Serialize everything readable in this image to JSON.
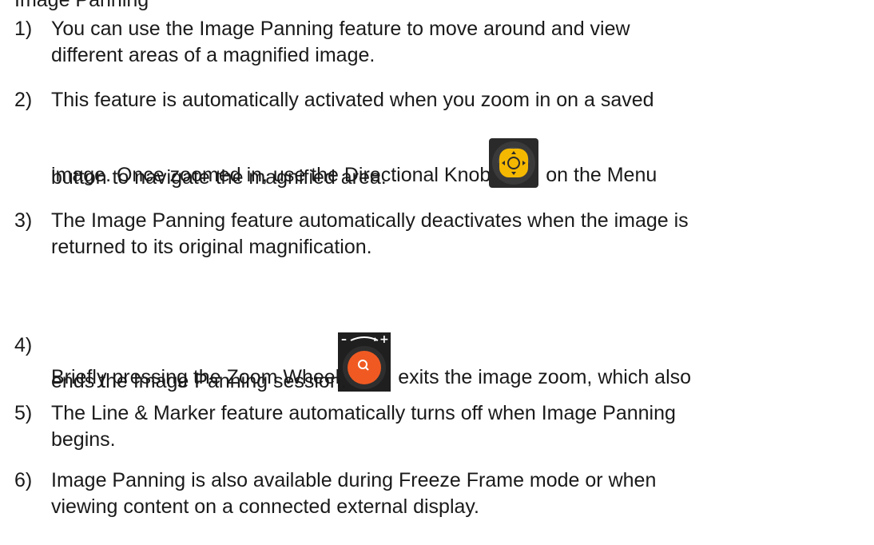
{
  "heading_partial": "Image Panning",
  "items": [
    {
      "num": "1)",
      "lines": [
        "You can use the Image Panning feature to move around and view",
        "different areas of a magnified image."
      ]
    },
    {
      "num": "2)",
      "line1": "This feature is automatically activated when you zoom in on a saved",
      "line2_before": "image. Once zoomed in, use the Directional Knob",
      "line2_after": " on the Menu",
      "line3": "button to navigate the magnified area."
    },
    {
      "num": "3)",
      "lines": [
        "The Image Panning feature automatically deactivates when the image is",
        "returned to its original magnification."
      ]
    },
    {
      "num": "4)",
      "line1_before": "Briefly pressing the Zoom Wheel",
      "line1_after": " exits the image zoom, which also",
      "line2": "ends the Image Panning session."
    },
    {
      "num": "5)",
      "lines": [
        "The Line & Marker feature automatically turns off when Image Panning",
        "begins."
      ]
    },
    {
      "num": "6)",
      "lines": [
        "Image Panning is also available during Freeze Frame mode or when",
        "viewing content on a connected external display."
      ]
    }
  ],
  "icons": {
    "knob": "directional-knob-icon",
    "wheel": "zoom-wheel-icon"
  },
  "colors": {
    "knob": "#f5b800",
    "wheel": "#f05a22",
    "dark": "#2a2a2a",
    "text": "#1a1a1a"
  }
}
